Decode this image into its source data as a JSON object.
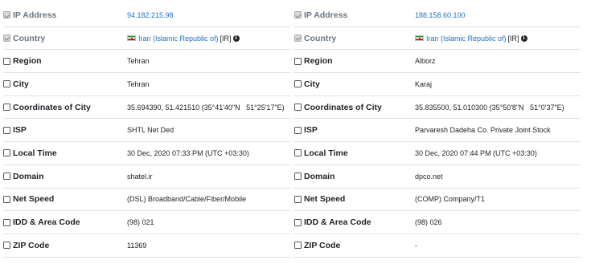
{
  "left": {
    "ip": {
      "label": "IP Address",
      "value": "94.182.215.98"
    },
    "country": {
      "label": "Country",
      "value": "Iran (Islamic Republic of)",
      "code": "[IR]"
    },
    "region": {
      "label": "Region",
      "value": "Tehran"
    },
    "city": {
      "label": "City",
      "value": "Tehran"
    },
    "coords": {
      "label": "Coordinates of City",
      "value": "35.694390, 51.421510 (35°41'40\"N   51°25'17\"E)"
    },
    "isp": {
      "label": "ISP",
      "value": "SHTL Net Ded"
    },
    "local_time": {
      "label": "Local Time",
      "value": "30 Dec, 2020 07:33 PM (UTC +03:30)"
    },
    "domain": {
      "label": "Domain",
      "value": "shatel.ir"
    },
    "net_speed": {
      "label": "Net Speed",
      "value": "(DSL) Broadband/Cable/Fiber/Mobile"
    },
    "idd": {
      "label": "IDD & Area Code",
      "value": "(98) 021"
    },
    "zip": {
      "label": "ZIP Code",
      "value": "11369"
    }
  },
  "right": {
    "ip": {
      "label": "IP Address",
      "value": "188.158.60.100"
    },
    "country": {
      "label": "Country",
      "value": "Iran (Islamic Republic of)",
      "code": "[IR]"
    },
    "region": {
      "label": "Region",
      "value": "Alborz"
    },
    "city": {
      "label": "City",
      "value": "Karaj"
    },
    "coords": {
      "label": "Coordinates of City",
      "value": "35.835500, 51.010300 (35°50'8\"N   51°0'37\"E)"
    },
    "isp": {
      "label": "ISP",
      "value": "Parvaresh Dadeha Co. Private Joint Stock"
    },
    "local_time": {
      "label": "Local Time",
      "value": "30 Dec, 2020 07:44 PM (UTC +03:30)"
    },
    "domain": {
      "label": "Domain",
      "value": "dpco.net"
    },
    "net_speed": {
      "label": "Net Speed",
      "value": "(COMP) Company/T1"
    },
    "idd": {
      "label": "IDD & Area Code",
      "value": "(98) 026"
    },
    "zip": {
      "label": "ZIP Code",
      "value": "-"
    }
  },
  "checkbox_state": {
    "ip": true,
    "country": true,
    "region": false,
    "city": false,
    "coords": false,
    "isp": false,
    "local_time": false,
    "domain": false,
    "net_speed": false,
    "idd": false,
    "zip": false
  },
  "icons": {
    "flag": "iran-flag-icon",
    "info": "info-icon"
  },
  "colors": {
    "link": "#1f6fc5",
    "border": "#dee2e6",
    "text": "#212529"
  }
}
